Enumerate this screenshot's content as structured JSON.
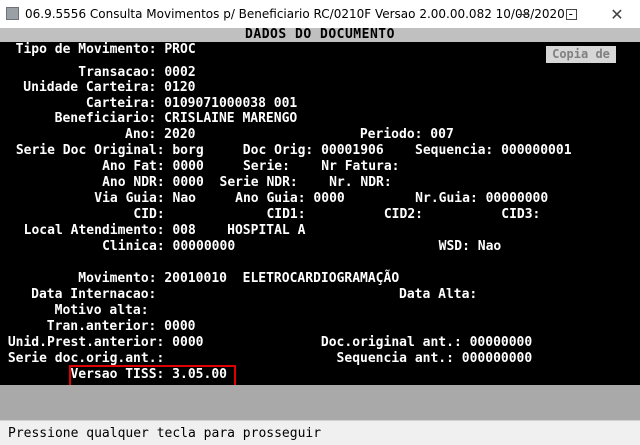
{
  "window": {
    "title": "06.9.5556 Consulta Movimentos p/ Beneficiario RC/0210F Versao 2.00.00.082 10/08/2020 -",
    "minimize_glyph": "",
    "close_glyph": "✕"
  },
  "header": {
    "title": "DADOS DO DOCUMENTO"
  },
  "copy_button": {
    "label": "Copia de"
  },
  "lines": [
    "  Tipo de Movimento: PROC",
    "",
    "          Transacao: 0002",
    "    Unidade Carteira: 0120",
    "            Carteira: 0109071000038 001",
    "        Beneficiario: CRISLAINE MARENGO",
    "                 Ano: 2020                     Periodo: 007",
    " Serie Doc Original: borg     Doc Orig: 00001906    Sequencia: 000000001",
    "           Ano Fat: 0000     Serie:    Nr Fatura:",
    "           Ano NDR: 0000  Serie NDR:    Nr. NDR:",
    "          Via Guia: Nao     Ano Guia: 0000         Nr.Guia: 00000000",
    "               CID:             CID1:          CID2:          CID3:",
    "  Local Atendimento: 008    HOSPITAL A",
    "           Clinica: 00000000                          WSD: Nao",
    "",
    "          Movimento: 20010010  ELETROCARDIOGRAMAÇÃO",
    "     Data Internacao:                               Data Alta:",
    "        Motivo alta:",
    "       Tran.anterior: 0000",
    " Unid.Prest.anterior: 0000               Doc.original ant.: 00000000",
    " Serie doc.orig.ant.:                      Sequencia ant.: 000000000",
    "         Versao TISS: 3.05.00"
  ],
  "status": {
    "message": "Pressione qualquer tecla para prosseguir"
  }
}
